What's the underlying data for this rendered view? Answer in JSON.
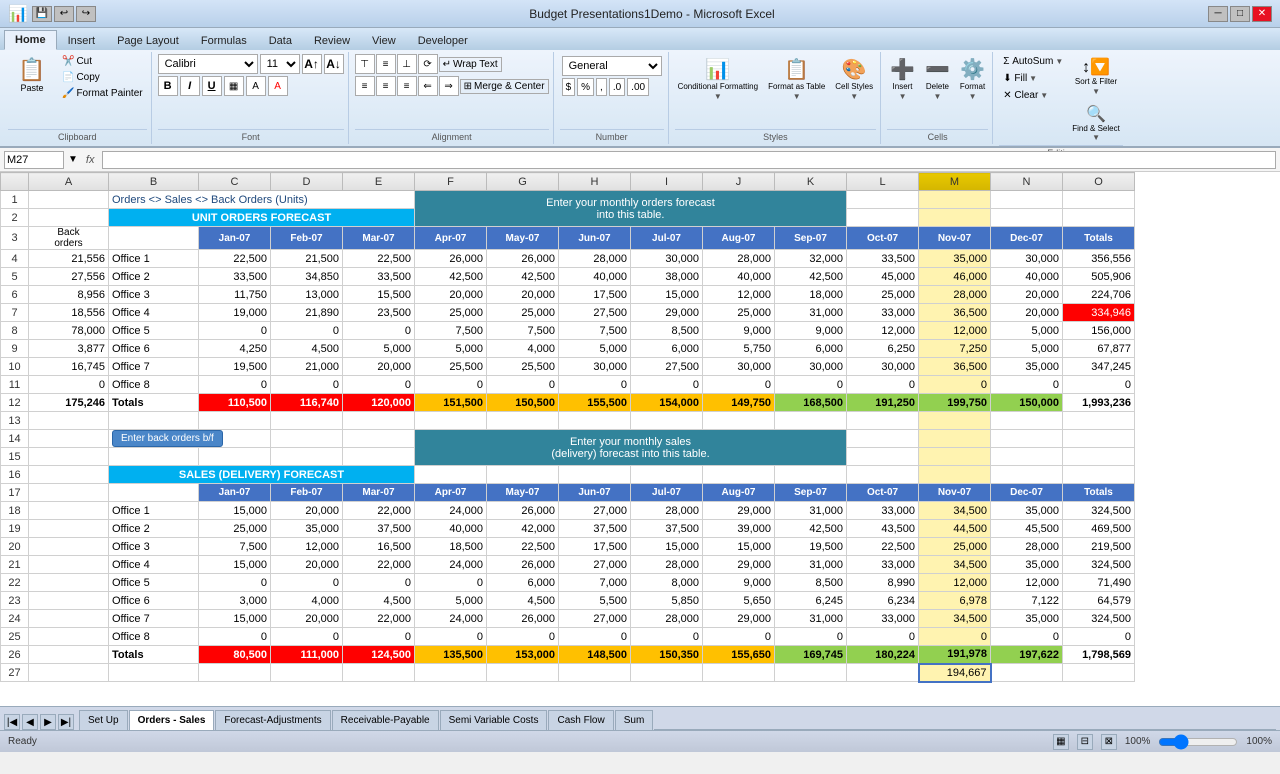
{
  "titlebar": {
    "title": "Budget Presentations1Demo - Microsoft Excel",
    "win_buttons": [
      "─",
      "□",
      "✕"
    ]
  },
  "quickaccess": {
    "buttons": [
      "💾",
      "↩",
      "↪",
      "▼"
    ]
  },
  "tabs": [
    "Home",
    "Insert",
    "Page Layout",
    "Formulas",
    "Data",
    "Review",
    "View",
    "Developer"
  ],
  "activeTab": "Home",
  "ribbon": {
    "groups": {
      "clipboard": {
        "label": "Clipboard",
        "paste_label": "Paste",
        "cut_label": "Cut",
        "copy_label": "Copy",
        "format_painter_label": "Format Painter"
      },
      "font": {
        "label": "Font",
        "font_name": "Calibri",
        "font_size": "11"
      },
      "alignment": {
        "label": "Alignment",
        "wrap_text": "Wrap Text",
        "merge_center": "Merge & Center"
      },
      "number": {
        "label": "Number",
        "format": "General"
      },
      "styles": {
        "label": "Styles",
        "conditional_formatting": "Conditional\nFormatting",
        "format_as_table": "Format\nas Table",
        "cell_styles": "Cell\nStyles"
      },
      "cells": {
        "label": "Cells",
        "insert": "Insert",
        "delete": "Delete",
        "format": "Format"
      },
      "editing": {
        "label": "Editing",
        "autosum": "AutoSum",
        "fill": "Fill",
        "clear": "Clear",
        "sort_filter": "Sort &\nFilter",
        "find_select": "Find &\nSelect"
      }
    }
  },
  "formulabar": {
    "cellref": "M27",
    "formula": ""
  },
  "col_headers": [
    "",
    "A",
    "B",
    "C",
    "D",
    "E",
    "F",
    "G",
    "H",
    "I",
    "J",
    "K",
    "L",
    "M",
    "N",
    "O"
  ],
  "rows": [
    {
      "num": 1,
      "cells": [
        "",
        "Orders <> Sales <> Back Orders (Units)",
        "",
        "",
        "",
        "",
        "Enter your monthly  orders forecast",
        "",
        "",
        "",
        "",
        "",
        "",
        "",
        "",
        ""
      ]
    },
    {
      "num": 2,
      "cells": [
        "",
        "",
        "UNIT ORDERS FORECAST",
        "",
        "",
        "",
        "into this table.",
        "",
        "",
        "",
        "",
        "",
        "",
        "",
        "",
        ""
      ]
    },
    {
      "num": 3,
      "cells": [
        "Back orders",
        "",
        "",
        "Jan-07",
        "Feb-07",
        "Mar-07",
        "Apr-07",
        "May-07",
        "Jun-07",
        "Jul-07",
        "Aug-07",
        "Sep-07",
        "Oct-07",
        "Nov-07",
        "Dec-07",
        "Totals"
      ]
    },
    {
      "num": 4,
      "cells": [
        "21,556",
        "Office 1",
        "",
        "22,500",
        "21,500",
        "22,500",
        "26,000",
        "26,000",
        "28,000",
        "30,000",
        "28,000",
        "32,000",
        "33,500",
        "35,000",
        "30,000",
        "356,556",
        ""
      ]
    },
    {
      "num": 5,
      "cells": [
        "27,556",
        "Office 2",
        "",
        "33,500",
        "34,850",
        "33,500",
        "42,500",
        "42,500",
        "40,000",
        "38,000",
        "40,000",
        "42,500",
        "45,000",
        "46,000",
        "40,000",
        "505,906",
        ""
      ]
    },
    {
      "num": 6,
      "cells": [
        "8,956",
        "Office 3",
        "",
        "11,750",
        "13,000",
        "15,500",
        "20,000",
        "20,000",
        "17,500",
        "15,000",
        "12,000",
        "18,000",
        "25,000",
        "28,000",
        "20,000",
        "224,706",
        ""
      ]
    },
    {
      "num": 7,
      "cells": [
        "18,556",
        "Office 4",
        "",
        "19,000",
        "21,890",
        "23,500",
        "25,000",
        "25,000",
        "27,500",
        "29,000",
        "25,000",
        "31,000",
        "33,000",
        "36,500",
        "20,000",
        "334,946",
        ""
      ]
    },
    {
      "num": 8,
      "cells": [
        "78,000",
        "Office 5",
        "",
        "0",
        "0",
        "0",
        "7,500",
        "7,500",
        "7,500",
        "8,500",
        "9,000",
        "9,000",
        "12,000",
        "12,000",
        "5,000",
        "156,000",
        ""
      ]
    },
    {
      "num": 9,
      "cells": [
        "3,877",
        "Office 6",
        "",
        "4,250",
        "4,500",
        "5,000",
        "5,000",
        "4,000",
        "5,000",
        "6,000",
        "5,750",
        "6,000",
        "6,250",
        "7,250",
        "5,000",
        "67,877",
        ""
      ]
    },
    {
      "num": 10,
      "cells": [
        "16,745",
        "Office 7",
        "",
        "19,500",
        "21,000",
        "20,000",
        "25,500",
        "25,500",
        "30,000",
        "27,500",
        "30,000",
        "30,000",
        "30,000",
        "36,500",
        "35,000",
        "30,000",
        "347,245"
      ]
    },
    {
      "num": 11,
      "cells": [
        "0",
        "Office 8",
        "",
        "0",
        "0",
        "0",
        "0",
        "0",
        "0",
        "0",
        "0",
        "0",
        "0",
        "0",
        "0",
        "0",
        ""
      ]
    },
    {
      "num": 12,
      "cells": [
        "175,246",
        "Totals",
        "",
        "110,500",
        "116,740",
        "120,000",
        "151,500",
        "150,500",
        "155,500",
        "154,000",
        "149,750",
        "168,500",
        "191,250",
        "199,750",
        "150,000",
        "1,993,236",
        ""
      ]
    },
    {
      "num": 13,
      "cells": [
        "",
        "",
        "",
        "",
        "",
        "",
        "",
        "",
        "",
        "",
        "",
        "",
        "",
        "",
        "",
        ""
      ]
    },
    {
      "num": 14,
      "cells": [
        "",
        "Enter back orders b/f",
        "",
        "",
        "",
        "",
        "Enter your monthly sales",
        "",
        "",
        "",
        "",
        "",
        "",
        "",
        "",
        ""
      ]
    },
    {
      "num": 15,
      "cells": [
        "",
        "",
        "",
        "",
        "",
        "",
        "(delivery) forecast into this table.",
        "",
        "",
        "",
        "",
        "",
        "",
        "",
        "",
        ""
      ]
    },
    {
      "num": 16,
      "cells": [
        "",
        "",
        "SALES (DELIVERY) FORECAST",
        "",
        "",
        "",
        "",
        "",
        "",
        "",
        "",
        "",
        "",
        "",
        "",
        ""
      ]
    },
    {
      "num": 17,
      "cells": [
        "",
        "",
        "Jan-07",
        "Feb-07",
        "Mar-07",
        "Apr-07",
        "May-07",
        "Jun-07",
        "Jul-07",
        "Aug-07",
        "Sep-07",
        "Oct-07",
        "Nov-07",
        "Dec-07",
        "Totals",
        ""
      ]
    },
    {
      "num": 18,
      "cells": [
        "",
        "Office 1",
        "",
        "15,000",
        "20,000",
        "22,000",
        "24,000",
        "26,000",
        "27,000",
        "28,000",
        "29,000",
        "31,000",
        "33,000",
        "34,500",
        "35,000",
        "324,500",
        ""
      ]
    },
    {
      "num": 19,
      "cells": [
        "",
        "Office 2",
        "",
        "25,000",
        "35,000",
        "37,500",
        "40,000",
        "42,000",
        "37,500",
        "37,500",
        "39,000",
        "42,500",
        "43,500",
        "44,500",
        "45,500",
        "469,500",
        ""
      ]
    },
    {
      "num": 20,
      "cells": [
        "",
        "Office 3",
        "",
        "7,500",
        "12,000",
        "16,500",
        "18,500",
        "22,500",
        "17,500",
        "15,000",
        "15,000",
        "19,500",
        "22,500",
        "25,000",
        "28,000",
        "219,500",
        ""
      ]
    },
    {
      "num": 21,
      "cells": [
        "",
        "Office 4",
        "",
        "15,000",
        "20,000",
        "22,000",
        "24,000",
        "26,000",
        "27,000",
        "28,000",
        "29,000",
        "31,000",
        "33,000",
        "34,500",
        "35,000",
        "324,500",
        ""
      ]
    },
    {
      "num": 22,
      "cells": [
        "",
        "Office 5",
        "",
        "0",
        "0",
        "0",
        "0",
        "6,000",
        "7,000",
        "8,000",
        "9,000",
        "8,500",
        "8,990",
        "12,000",
        "12,000",
        "71,490",
        ""
      ]
    },
    {
      "num": 23,
      "cells": [
        "",
        "Office 6",
        "",
        "3,000",
        "4,000",
        "4,500",
        "5,000",
        "4,500",
        "5,500",
        "5,850",
        "5,650",
        "6,245",
        "6,234",
        "6,978",
        "7,122",
        "64,579",
        ""
      ]
    },
    {
      "num": 24,
      "cells": [
        "",
        "Office 7",
        "",
        "15,000",
        "20,000",
        "22,000",
        "24,000",
        "26,000",
        "27,000",
        "28,000",
        "29,000",
        "31,000",
        "33,000",
        "34,500",
        "35,000",
        "324,500",
        ""
      ]
    },
    {
      "num": 25,
      "cells": [
        "",
        "Office 8",
        "",
        "0",
        "0",
        "0",
        "0",
        "0",
        "0",
        "0",
        "0",
        "0",
        "0",
        "0",
        "0",
        "0",
        ""
      ]
    },
    {
      "num": 26,
      "cells": [
        "",
        "Totals",
        "",
        "80,500",
        "111,000",
        "124,500",
        "135,500",
        "153,000",
        "148,500",
        "150,350",
        "155,650",
        "169,745",
        "180,224",
        "191,978",
        "197,622",
        "1,798,569",
        ""
      ]
    },
    {
      "num": 27,
      "cells": [
        "",
        "",
        "",
        "",
        "",
        "",
        "",
        "",
        "",
        "",
        "",
        "",
        "",
        "",
        "194,667",
        ""
      ]
    }
  ],
  "sheettabs": {
    "tabs": [
      "Set Up",
      "Orders - Sales",
      "Forecast-Adjustments",
      "Receivable-Payable",
      "Semi Variable Costs",
      "Cash Flow",
      "Sum"
    ],
    "active": "Orders - Sales"
  },
  "statusbar": {
    "ready": "Ready"
  }
}
